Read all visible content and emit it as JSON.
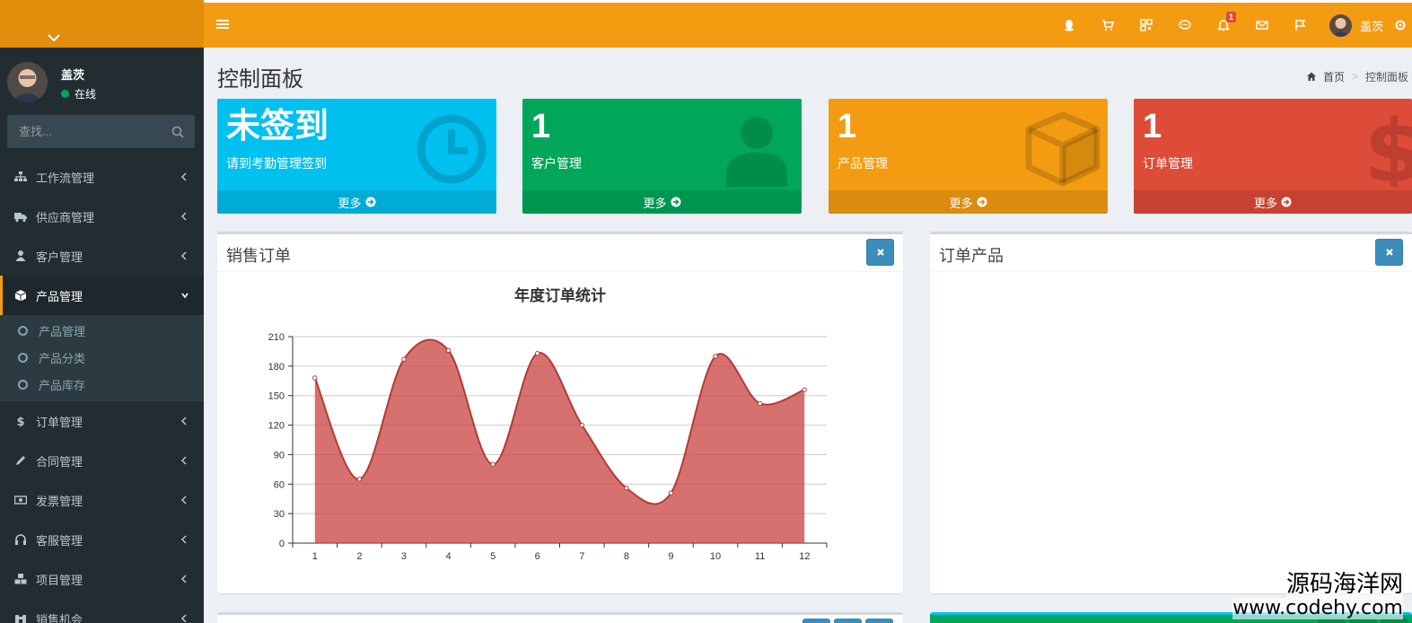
{
  "header": {
    "notification_count": "1",
    "user_name": "盖茨",
    "colors": {
      "navbar": "#f39c12",
      "logo": "#e08e0b"
    }
  },
  "sidebar": {
    "user_name": "盖茨",
    "user_status": "在线",
    "search_placeholder": "查找...",
    "items": [
      {
        "label": "工作流管理",
        "icon": "sitemap-icon"
      },
      {
        "label": "供应商管理",
        "icon": "truck-icon"
      },
      {
        "label": "客户管理",
        "icon": "user-icon"
      },
      {
        "label": "产品管理",
        "icon": "cube-icon",
        "active": true
      },
      {
        "label": "订单管理",
        "icon": "dollar-icon"
      },
      {
        "label": "合同管理",
        "icon": "pencil-icon"
      },
      {
        "label": "发票管理",
        "icon": "money-icon"
      },
      {
        "label": "客服管理",
        "icon": "headphones-icon"
      },
      {
        "label": "项目管理",
        "icon": "cubes-icon"
      },
      {
        "label": "销售机会",
        "icon": "binoculars-icon"
      }
    ],
    "subitems": [
      "产品管理",
      "产品分类",
      "产品库存"
    ]
  },
  "content": {
    "page_title": "控制面板",
    "breadcrumb": {
      "home": "首页",
      "current": "控制面板"
    }
  },
  "boxes": [
    {
      "value": "未签到",
      "label": "请到考勤管理签到",
      "more": "更多",
      "color": "#00c0ef",
      "icon": "clock-icon"
    },
    {
      "value": "1",
      "label": "客户管理",
      "more": "更多",
      "color": "#00a65a",
      "icon": "user-icon"
    },
    {
      "value": "1",
      "label": "产品管理",
      "more": "更多",
      "color": "#f39c12",
      "icon": "cube-icon"
    },
    {
      "value": "1",
      "label": "订单管理",
      "more": "更多",
      "color": "#dd4b39",
      "icon": "dollar-icon"
    }
  ],
  "panels": {
    "sales_orders": {
      "title": "销售订单"
    },
    "order_products": {
      "title": "订单产品"
    }
  },
  "chart_data": {
    "type": "area",
    "title": "年度订单统计",
    "x": [
      1,
      2,
      3,
      4,
      5,
      6,
      7,
      8,
      9,
      10,
      11,
      12
    ],
    "series": [
      {
        "values": [
          168,
          65,
          187,
          196,
          80,
          193,
          120,
          56,
          51,
          190,
          142,
          156
        ]
      }
    ],
    "ylim": [
      0,
      210
    ],
    "yticks": [
      0,
      30,
      60,
      90,
      120,
      150,
      180,
      210
    ],
    "grid": true,
    "color": "#c9413f"
  },
  "watermark": {
    "line1": "源码海洋网",
    "line2": "www.codehy.com"
  }
}
